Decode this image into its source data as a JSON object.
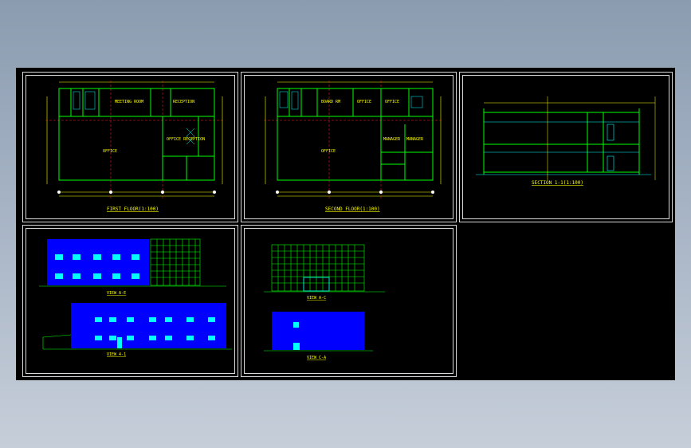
{
  "colors": {
    "background": "#000000",
    "frame": "#d8d8d8",
    "wall": "#00ff00",
    "dimension": "#ffff00",
    "axis": "#ff2020",
    "facade": "#0000ff",
    "detail": "#00ffff",
    "text": "#ffff00"
  },
  "sheets": [
    {
      "title": "FIRST FLOOR(1:100)",
      "rooms": [
        "MEETING ROOM",
        "RECEPTION",
        "OFFICE",
        "OFFICE  RECEPTION"
      ]
    },
    {
      "title": "SECOND FLOOR(1:100)",
      "rooms": [
        "BOARD RM",
        "OFFICE",
        "OFFICE",
        "MANAGER",
        "MANAGER",
        "OFFICE"
      ]
    },
    {
      "title": "SECTION 1-1(1:100)"
    },
    {
      "title_a": "VIEW A-E",
      "title_b": "VIEW 4-1"
    },
    {
      "title_a": "VIEW A-C",
      "title_b": "VIEW C-A"
    }
  ]
}
